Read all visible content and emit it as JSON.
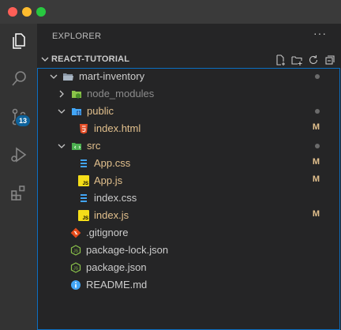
{
  "sidebar": {
    "header": "EXPLORER",
    "more": "···",
    "section_title": "REACT-TUTORIAL"
  },
  "activity": {
    "source_control_badge": "13",
    "icons": [
      "explorer-icon",
      "search-icon",
      "source-control-icon",
      "run-debug-icon",
      "extensions-icon"
    ]
  },
  "colors": {
    "modified": "#e2c08d",
    "accent_border": "#0b6fc3",
    "badge": "#0e639c"
  },
  "tree": [
    {
      "label": "mart-inventory",
      "type": "folder-open",
      "status": "dot"
    },
    {
      "label": "node_modules",
      "type": "folder-closed",
      "status": ""
    },
    {
      "label": "public",
      "type": "folder-open",
      "status": "dot"
    },
    {
      "label": "index.html",
      "type": "html",
      "status": "M"
    },
    {
      "label": "src",
      "type": "folder-open",
      "status": "dot"
    },
    {
      "label": "App.css",
      "type": "css",
      "status": "M"
    },
    {
      "label": "App.js",
      "type": "js",
      "status": "M"
    },
    {
      "label": "index.css",
      "type": "css",
      "status": ""
    },
    {
      "label": "index.js",
      "type": "js",
      "status": "M"
    },
    {
      "label": ".gitignore",
      "type": "git",
      "status": ""
    },
    {
      "label": "package-lock.json",
      "type": "npm",
      "status": ""
    },
    {
      "label": "package.json",
      "type": "npm",
      "status": ""
    },
    {
      "label": "README.md",
      "type": "info",
      "status": ""
    }
  ]
}
